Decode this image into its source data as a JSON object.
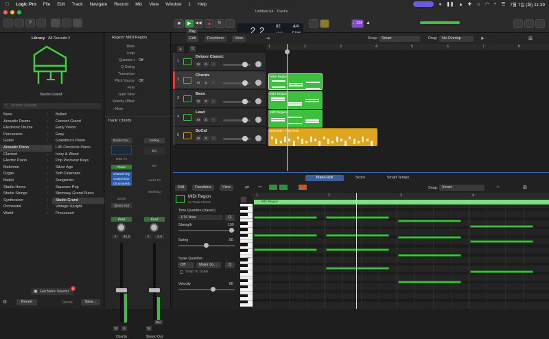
{
  "menubar": {
    "app": "Logic Pro",
    "items": [
      "File",
      "Edit",
      "Track",
      "Navigate",
      "Record",
      "Mix",
      "View",
      "Window",
      "1",
      "Help"
    ],
    "clock": "7월 7일 (화) 11:39"
  },
  "toolbar": {
    "doc_title": "Untitled 64 - Tracks",
    "tooltip": "Play",
    "lcd_bar": "2",
    "lcd_beat": "2",
    "lcd_tempo": "82",
    "lcd_tempo_label": "KEEP",
    "lcd_sig": "4/4",
    "lcd_key": "Cmaj",
    "count_in": "♩234"
  },
  "library": {
    "title": "Library",
    "filter": "All Sounds ◊",
    "patch_name": "Studio Grand",
    "search_placeholder": "Search Sounds",
    "categories": [
      {
        "label": "Bass"
      },
      {
        "label": "Acoustic Drums"
      },
      {
        "label": "Electronic Drums"
      },
      {
        "label": "Percussion"
      },
      {
        "label": "Guitar"
      },
      {
        "label": "Acoustic Piano",
        "selected": true
      },
      {
        "label": "Clavinet"
      },
      {
        "label": "Electric Piano"
      },
      {
        "label": "Mellotron"
      },
      {
        "label": "Organ"
      },
      {
        "label": "Mallet"
      },
      {
        "label": "Studio Horns"
      },
      {
        "label": "Studio Strings"
      },
      {
        "label": "Synthesizer"
      },
      {
        "label": "Orchestral"
      },
      {
        "label": "World"
      }
    ],
    "patches": [
      {
        "label": "Ballad"
      },
      {
        "label": "Concert Grand"
      },
      {
        "label": "Early Vision"
      },
      {
        "label": "Easy"
      },
      {
        "label": "Grandma's Piano"
      },
      {
        "label": "I-95 Chronicle Piano"
      },
      {
        "label": "Ivory & Wood"
      },
      {
        "label": "Pop Producer Keys"
      },
      {
        "label": "Silver Age"
      },
      {
        "label": "Soft Cinematic"
      },
      {
        "label": "Songwriter"
      },
      {
        "label": "Squeeze Pop"
      },
      {
        "label": "Steinway Grand Piano"
      },
      {
        "label": "Studio Grand",
        "selected": true
      },
      {
        "label": "Vintage Upright"
      },
      {
        "label": "Processed"
      }
    ],
    "get_more": "Get More Sounds",
    "get_more_badge": "6",
    "revert": "Revert",
    "delete": "Delete",
    "save": "Save..."
  },
  "inspector": {
    "region_header": "Region: MIDI Region",
    "params": [
      {
        "label": "Mute:",
        "value": ""
      },
      {
        "label": "Loop:",
        "value": ""
      },
      {
        "label": "Quantize ◊",
        "value": "Off"
      },
      {
        "label": "Q-Swing:",
        "value": ""
      },
      {
        "label": "Transpose:",
        "value": ""
      },
      {
        "label": "Pitch Source:",
        "value": "Off"
      },
      {
        "label": "Fine:",
        "value": ""
      },
      {
        "label": "Gate Time:",
        "value": ""
      },
      {
        "label": "Velocity Offset:",
        "value": ""
      }
    ],
    "more": "› More",
    "track_header": "Track: Chords",
    "strip_a": {
      "setting": "Studio Gra...",
      "midi_fx": "MIDI FX",
      "instrument": "Piano",
      "fx": [
        "Channel EQ",
        "Compressor",
        "ChromaVerb"
      ],
      "sends": "Sends",
      "output": "Stereo Out",
      "mode": "Read",
      "pan": "0",
      "gain": "-11.2",
      "mute": "M",
      "solo": "S",
      "name": "Chords"
    },
    "strip_b": {
      "setting": "Setting",
      "eq": "EQ",
      "io": "I/O",
      "audio_fx": "Audio FX",
      "metering": "Metering",
      "mode": "Read",
      "pan": "0",
      "gain": "-3.0",
      "mute": "M",
      "bounce": "Bnc",
      "name": "Stereo Out"
    }
  },
  "tracks": {
    "edit_menu": "Edit",
    "functions_menu": "Functions",
    "view_menu": "View",
    "snap_label": "Snap:",
    "snap_value": "Smart",
    "drag_label": "Drag:",
    "drag_value": "No Overlap",
    "ruler": [
      "1",
      "2",
      "3",
      "4",
      "5",
      "6",
      "7",
      "8",
      "9"
    ],
    "list": [
      {
        "num": "1",
        "name": "Deluxe Classic",
        "color": "#3fbf3f"
      },
      {
        "num": "2",
        "name": "Chords",
        "color": "#3fbf3f"
      },
      {
        "num": "3",
        "name": "Bass",
        "color": "#3fbf3f"
      },
      {
        "num": "4",
        "name": "Lead",
        "color": "#3fbf3f"
      },
      {
        "num": "5",
        "name": "SoCal",
        "color": "#e0a51e"
      }
    ],
    "regions": [
      {
        "label": "MIDI Region",
        "track": 2
      },
      {
        "label": "MIDI Region",
        "track": 3
      },
      {
        "label": "MIDI Region",
        "track": 4
      },
      {
        "label": "Drummer - Pop Rock",
        "track": 5
      }
    ]
  },
  "editor": {
    "tabs": [
      "Piano Roll",
      "Score",
      "Smart Tempo"
    ],
    "active_tab": "Piano Roll",
    "edit_menu": "Edit",
    "functions_menu": "Functions",
    "view_menu": "View",
    "snap_label": "Snap:",
    "snap_value": "Smart",
    "region_name": "MIDI Region",
    "region_track": "on Track Chords",
    "time_quantize_label": "Time Quantize (classic)",
    "time_quantize_value": "1/16 Note",
    "q_button": "Q",
    "strength_label": "Strength",
    "strength_value": "100",
    "swing_label": "Swing",
    "swing_value": "50",
    "scale_quantize_label": "Scale Quantize",
    "scale_off": "Off",
    "scale_key": "Major (lo...",
    "snap_to_scale": "Snap To Scale",
    "velocity_label": "Velocity",
    "velocity_value": "80",
    "ruler": [
      "1",
      "2",
      "3",
      "4"
    ],
    "key_label": "C3",
    "region_strip_label": "MIDI Region"
  },
  "colors": {
    "accent_green": "#3fbf3f",
    "drummer_yellow": "#e0a51e",
    "selection_blue": "#3b6fb8"
  }
}
